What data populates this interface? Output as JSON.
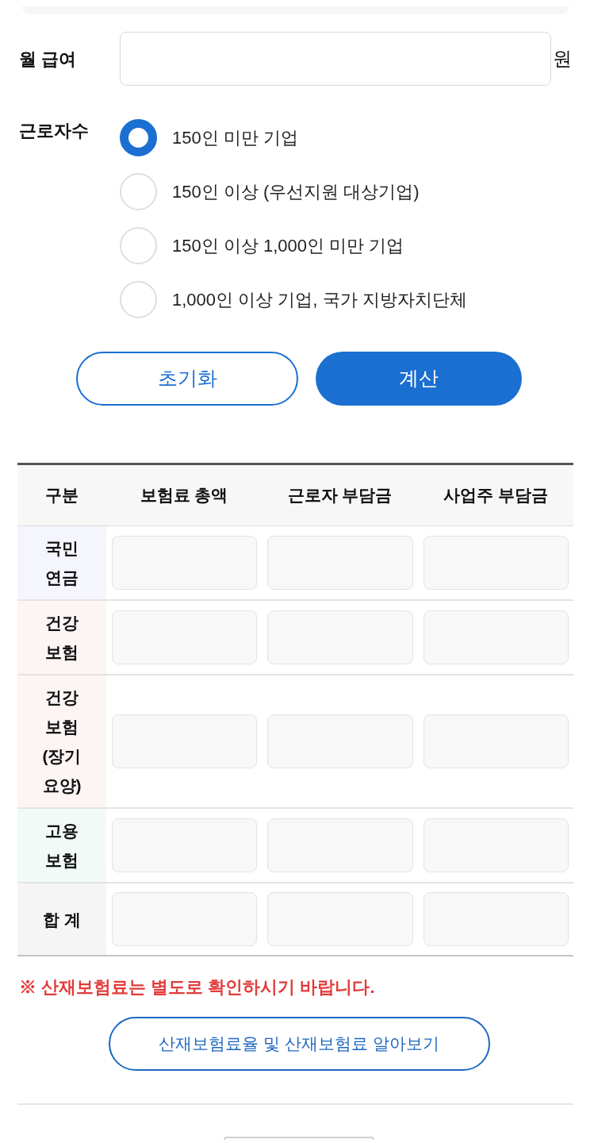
{
  "salary": {
    "label": "월 급여",
    "unit": "원"
  },
  "employees": {
    "label": "근로자수",
    "options": [
      {
        "label": "150인 미만 기업",
        "selected": true
      },
      {
        "label": "150인 이상 (우선지원 대상기업)",
        "selected": false
      },
      {
        "label": "150인 이상 1,000인 미만 기업",
        "selected": false
      },
      {
        "label": "1,000인 이상 기업, 국가 지방자치단체",
        "selected": false
      }
    ]
  },
  "buttons": [
    {
      "label": "초기화",
      "kind": "outline"
    },
    {
      "label": "계산",
      "kind": "primary"
    }
  ],
  "table": {
    "columns": [
      "구분",
      "보험료 총액",
      "근로자 부담금",
      "사업주 부담금"
    ],
    "rows": [
      {
        "label_lines": [
          "국민",
          "연금"
        ],
        "color": "#f4f5fd"
      },
      {
        "label_lines": [
          "건강",
          "보험"
        ],
        "color": "#fdf4f4"
      },
      {
        "label_lines": [
          "건강",
          "보험",
          "(장기",
          "요양)"
        ],
        "color": "#fdf4f4"
      },
      {
        "label_lines": [
          "고용",
          "보험"
        ],
        "color": "#f1faf6"
      },
      {
        "label_lines": [
          "합 계"
        ],
        "color": "#f5f5f5"
      }
    ]
  },
  "notice": "※ 산재보험료는 별도로 확인하시기 바랍니다.",
  "link_button": {
    "label": "산재보험료율 및 산재보험료 알아보기"
  }
}
